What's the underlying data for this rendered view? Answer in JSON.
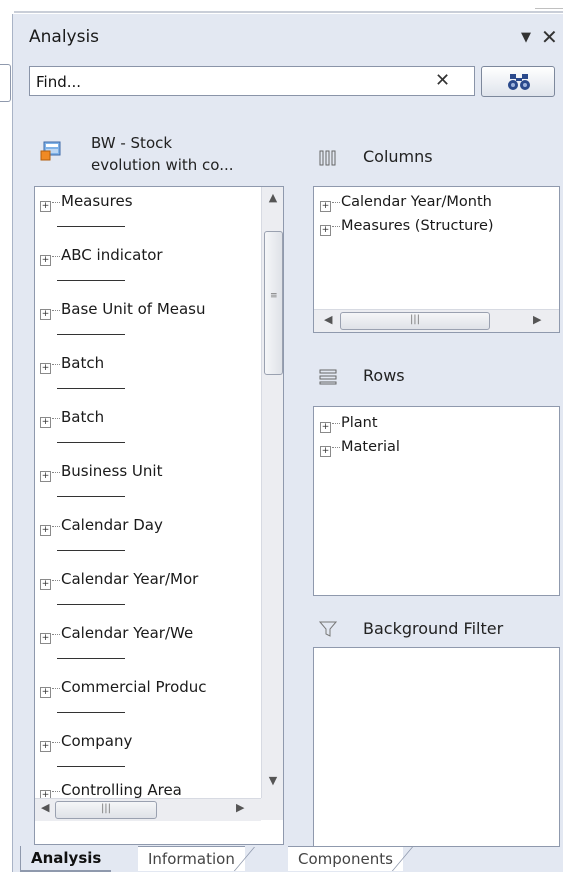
{
  "panel": {
    "title": "Analysis",
    "dropdown_glyph": "▼",
    "close_glyph": "✕"
  },
  "search": {
    "value": "Find...",
    "clear_glyph": "✕",
    "binoculars_glyph": "🔭"
  },
  "datasource": {
    "line1": "BW - Stock",
    "line2": "evolution with co..."
  },
  "objects": [
    {
      "label": "Measures"
    },
    {
      "label": "ABC indicator"
    },
    {
      "label": "Base Unit of Measu"
    },
    {
      "label": "Batch"
    },
    {
      "label": "Batch"
    },
    {
      "label": "Business Unit"
    },
    {
      "label": "Calendar Day"
    },
    {
      "label": "Calendar Year/Mor"
    },
    {
      "label": "Calendar Year/We"
    },
    {
      "label": "Commercial Produc"
    },
    {
      "label": "Company"
    },
    {
      "label": "Controlling Area"
    }
  ],
  "columns": {
    "label": "Columns",
    "items": [
      {
        "label": "Calendar Year/Month"
      },
      {
        "label": "Measures (Structure)"
      }
    ]
  },
  "rows": {
    "label": "Rows",
    "items": [
      {
        "label": "Plant"
      },
      {
        "label": "Material"
      }
    ]
  },
  "background_filter": {
    "label": "Background Filter"
  },
  "tabs": [
    {
      "label": "Analysis",
      "active": true
    },
    {
      "label": "Information",
      "active": false
    },
    {
      "label": "Components",
      "active": false
    }
  ],
  "colors": {
    "panel_bg": "#e3e8f2",
    "border": "#8f99ad"
  }
}
